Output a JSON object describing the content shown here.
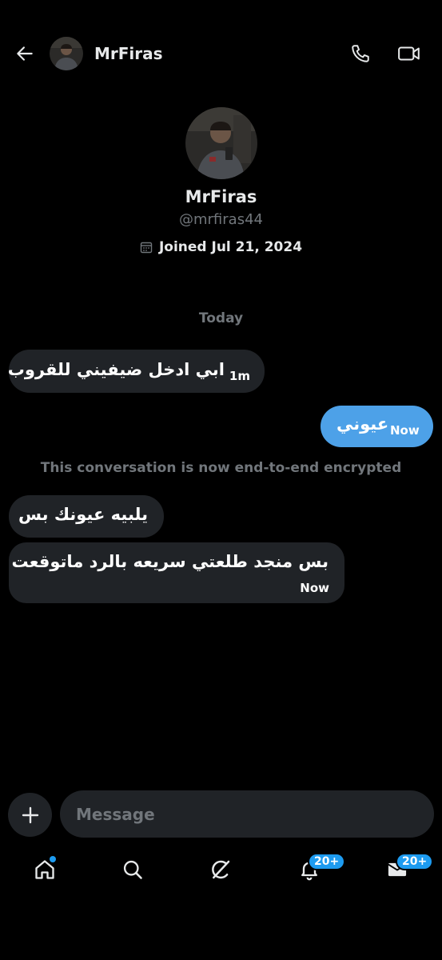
{
  "header": {
    "name": "MrFiras",
    "icons": {
      "back": "arrow-left-icon",
      "call": "phone-icon",
      "video": "video-camera-icon"
    }
  },
  "profile": {
    "name": "MrFiras",
    "handle": "@mrfiras44",
    "joined": "Joined Jul 21, 2024",
    "joined_icon": "calendar-icon"
  },
  "conversation": {
    "day_label": "Today",
    "encryption_note": "This conversation is now end-to-end encrypted",
    "messages": [
      {
        "direction": "incoming",
        "text": "ابي ادخل ضيفيني للقروب",
        "time": "1m"
      },
      {
        "direction": "outgoing",
        "text": "عيوني",
        "time": "Now"
      },
      {
        "direction": "incoming",
        "text": "يلبيه عيونك بس",
        "time": ""
      },
      {
        "direction": "incoming",
        "text": "بس منجد طلعتي سريعه بالرد ماتوقعت",
        "time": "Now"
      }
    ]
  },
  "compose": {
    "placeholder": "Message",
    "add_icon": "plus-icon"
  },
  "tabbar": {
    "items": [
      {
        "name": "home",
        "icon": "home-icon",
        "has_dot": true
      },
      {
        "name": "search",
        "icon": "search-icon"
      },
      {
        "name": "grok",
        "icon": "grok-icon"
      },
      {
        "name": "notifications",
        "icon": "bell-icon",
        "badge": "20+"
      },
      {
        "name": "messages",
        "icon": "envelope-icon",
        "badge": "20+"
      }
    ]
  },
  "colors": {
    "background": "#000000",
    "incoming_bubble": "#202327",
    "outgoing_bubble": "#4da1e8",
    "accent": "#1d9bf0",
    "muted_text": "#71767b"
  }
}
